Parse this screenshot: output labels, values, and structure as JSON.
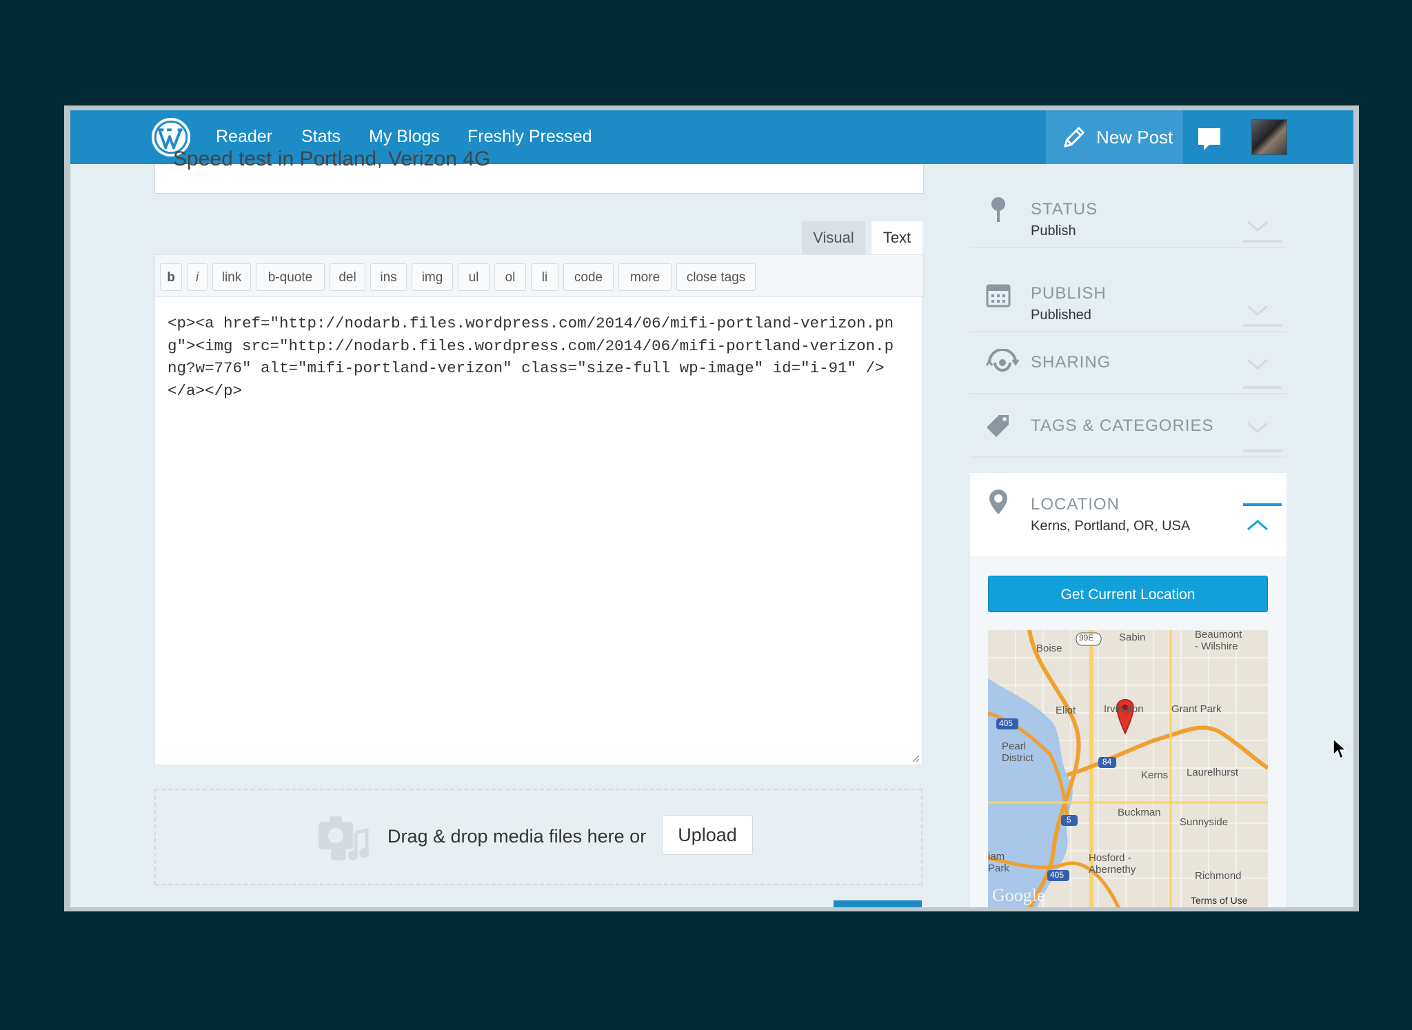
{
  "topbar": {
    "nav": [
      "Reader",
      "Stats",
      "My Blogs",
      "Freshly Pressed"
    ],
    "new_post_label": "New Post"
  },
  "post": {
    "title_partial": "Speed test in Portland, Verizon 4G"
  },
  "editor": {
    "tabs": [
      "Visual",
      "Text"
    ],
    "active_tab": "Text",
    "quicktags": [
      "b",
      "i",
      "link",
      "b-quote",
      "del",
      "ins",
      "img",
      "ul",
      "ol",
      "li",
      "code",
      "more",
      "close tags"
    ],
    "content": "<p><a href=\"http://nodarb.files.wordpress.com/2014/06/mifi-portland-verizon.png\"><img src=\"http://nodarb.files.wordpress.com/2014/06/mifi-portland-verizon.png?w=776\" alt=\"mifi-portland-verizon\" class=\"size-full wp-image\" id=\"i-91\" /></a></p>"
  },
  "media": {
    "drop_text": "Drag & drop media files here or",
    "upload_label": "Upload"
  },
  "sidebar": {
    "status": {
      "title": "STATUS",
      "value": "Publish"
    },
    "publish": {
      "title": "PUBLISH",
      "value": "Published"
    },
    "sharing": {
      "title": "SHARING"
    },
    "tags": {
      "title": "TAGS & CATEGORIES"
    },
    "location": {
      "title": "LOCATION",
      "value": "Kerns, Portland, OR, USA",
      "button": "Get Current Location",
      "map_labels": {
        "boise": "Boise",
        "hwy": "99E",
        "sabin": "Sabin",
        "beaumont": "Beaumont\n- Wilshire",
        "eliot": "Eliot",
        "irvington": "Irvington",
        "grant_park": "Grant Park",
        "i405a": "405",
        "pearl": "Pearl\nDistrict",
        "i84": "84",
        "kerns": "Kerns",
        "laurelhurst": "Laurelhurst",
        "i5": "5",
        "buckman": "Buckman",
        "sunnyside": "Sunnyside",
        "william": "iam\nPark",
        "i405b": "405",
        "hosford": "Hosford -\nAbernethy",
        "richmond": "Richmond",
        "google": "Google",
        "terms": "Terms of Use"
      }
    }
  },
  "colors": {
    "brand_blue": "#1d8cc6",
    "button_blue": "#11a0d9",
    "background": "#022a35",
    "pin_red": "#e0312b",
    "road_orange": "#f0a030"
  }
}
